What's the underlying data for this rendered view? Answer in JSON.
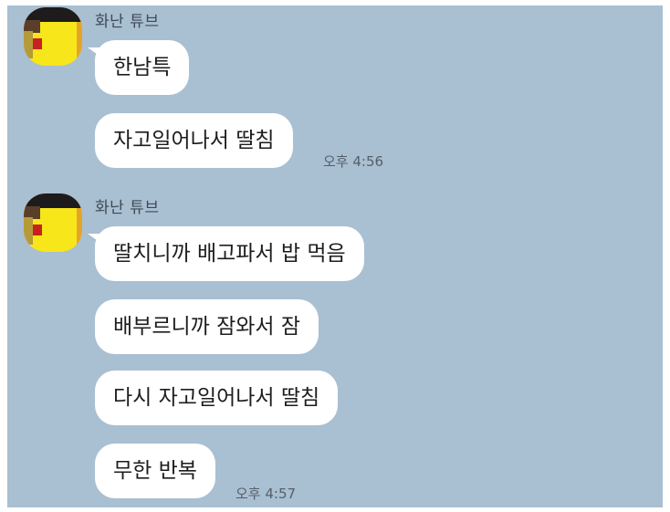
{
  "chat": {
    "groups": [
      {
        "sender": "화난 튜브",
        "messages": [
          "한남특",
          "자고일어나서 딸침"
        ],
        "time": "오후 4:56"
      },
      {
        "sender": "화난 튜브",
        "messages": [
          "딸치니까 배고파서 밥 먹음",
          "배부르니까 잠와서 잠",
          "다시 자고일어나서 딸침",
          "무한 반복"
        ],
        "time": "오후 4:57"
      }
    ],
    "colors": {
      "background": "#a9bfd2",
      "bubble": "#ffffff",
      "avatar": "#f7e61a"
    }
  }
}
